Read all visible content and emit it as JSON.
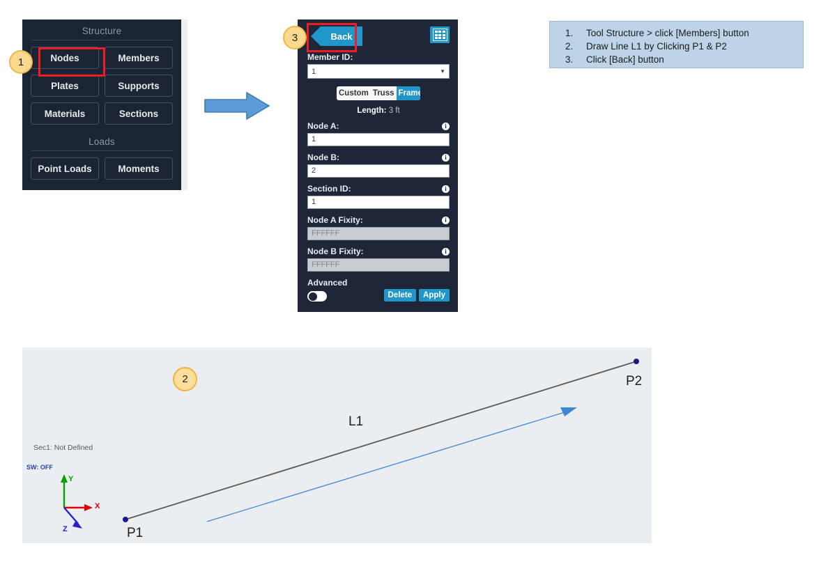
{
  "tool_panel": {
    "groups": [
      {
        "title": "Structure",
        "rows": [
          [
            "Nodes",
            "Members"
          ],
          [
            "Plates",
            "Supports"
          ],
          [
            "Materials",
            "Sections"
          ]
        ]
      },
      {
        "title": "Loads",
        "rows": [
          [
            "Point Loads",
            "Moments"
          ]
        ]
      }
    ]
  },
  "badges": {
    "one": "1",
    "two": "2",
    "three": "3"
  },
  "props_panel": {
    "back_label": "Back",
    "grid_icon": "table-grid-icon",
    "member_id_label": "Member ID:",
    "member_id_value": "1",
    "segmented": {
      "options": [
        "Custom",
        "Truss",
        "Frame"
      ],
      "selected": "Frame"
    },
    "length_label": "Length:",
    "length_value": "3 ft",
    "fields": [
      {
        "label": "Node A:",
        "value": "1",
        "disabled": false
      },
      {
        "label": "Node B:",
        "value": "2",
        "disabled": false
      },
      {
        "label": "Section ID:",
        "value": "1",
        "disabled": false
      },
      {
        "label": "Node A Fixity:",
        "value": "FFFFFF",
        "disabled": true
      },
      {
        "label": "Node B Fixity:",
        "value": "FFFFFF",
        "disabled": true
      }
    ],
    "advanced_label": "Advanced",
    "advanced_on": false,
    "delete_label": "Delete",
    "apply_label": "Apply",
    "info_icon": "info-icon"
  },
  "instructions": [
    {
      "num": "1.",
      "text": "Tool Structure > click [Members] button"
    },
    {
      "num": "2.",
      "text": "Draw Line L1 by Clicking P1 & P2"
    },
    {
      "num": "3.",
      "text": "Click [Back] button"
    }
  ],
  "canvas": {
    "section_status": "Sec1: Not Defined",
    "self_weight_status": "SW: OFF",
    "member_label": "L1",
    "node_a_label": "P1",
    "node_b_label": "P2",
    "axes": {
      "x": "X",
      "y": "Y",
      "z": "Z"
    }
  },
  "colors": {
    "panel_bg": "#1e2637",
    "tool_panel_bg": "#1b2433",
    "accent_blue": "#2196c8",
    "highlight_red": "#ee1c25",
    "badge_fill": "#fbd98f",
    "canvas_bg": "#eaeef1",
    "instructions_bg": "#bdd3e8",
    "axis_x": "#e00000",
    "axis_y": "#00a000",
    "axis_z": "#2222cc",
    "member_line": "#5a5a5a",
    "node_dot": "#1a1a8c",
    "flow_arrow": "#5b9bd5"
  }
}
